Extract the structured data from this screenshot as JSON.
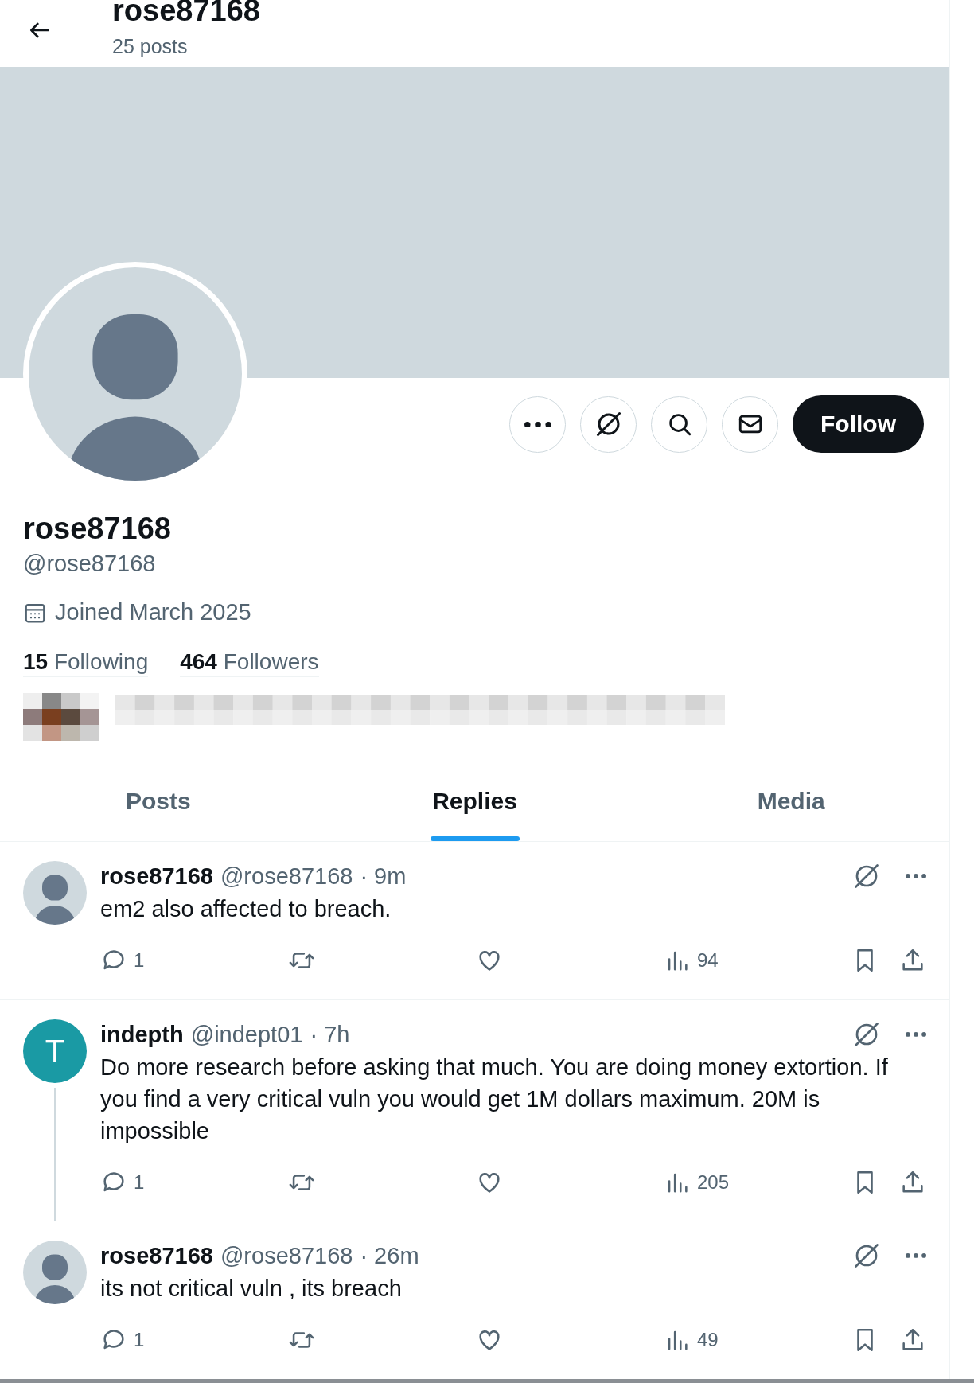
{
  "header": {
    "title": "rose87168",
    "post_count": "25 posts"
  },
  "profile": {
    "name": "rose87168",
    "handle": "@rose87168",
    "joined": "Joined March 2025",
    "following_count": "15",
    "following_label": "Following",
    "followers_count": "464",
    "followers_label": "Followers"
  },
  "action_buttons": [
    {
      "kind": "more"
    },
    {
      "kind": "grok"
    },
    {
      "kind": "search"
    },
    {
      "kind": "message"
    }
  ],
  "follow_button": {
    "label": "Follow"
  },
  "tabs": [
    {
      "label": "Posts",
      "selected": false
    },
    {
      "label": "Replies",
      "selected": true
    },
    {
      "label": "Media",
      "selected": false
    }
  ],
  "posts": [
    {
      "avatar": {
        "kind": "silhouette"
      },
      "name": "rose87168",
      "handle": "@rose87168",
      "time": "· 9m",
      "text": "em2 also affected to breach.",
      "replies": "1",
      "views": "94",
      "thread_below": false,
      "divider_below": true
    },
    {
      "avatar": {
        "kind": "letter",
        "letter": "T"
      },
      "name": "indepth",
      "handle": "@indept01",
      "time": "· 7h",
      "text": "Do more research before asking that much. You are doing money extortion. If you find a very critical vuln you would get 1M dollars maximum. 20M is impossible",
      "replies": "1",
      "views": "205",
      "thread_below": true,
      "divider_below": false
    },
    {
      "avatar": {
        "kind": "silhouette"
      },
      "name": "rose87168",
      "handle": "@rose87168",
      "time": "· 26m",
      "text": "its not critical vuln , its breach",
      "replies": "1",
      "views": "49",
      "thread_below": false,
      "divider_below": false
    }
  ]
}
